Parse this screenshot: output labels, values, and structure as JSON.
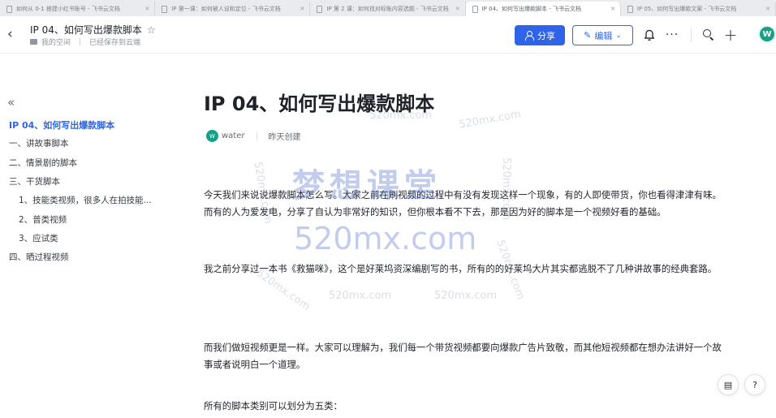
{
  "tabs": [
    {
      "label": "如何从 0-1 搭建小红书账号 - 飞书云文档",
      "active": false
    },
    {
      "label": "IP 第一课：如何被人设和定位 - 飞书云文档",
      "active": false
    },
    {
      "label": "IP 第 2 课：如何找对标账内容选题 - 飞书云文档",
      "active": false
    },
    {
      "label": "IP 04、如何写出爆款脚本 - 飞书云文档",
      "active": true
    },
    {
      "label": "IP 05、如何写出爆款文案 - 飞书云文档",
      "active": false
    }
  ],
  "header": {
    "title": "IP 04、如何写出爆款脚本",
    "location": "我的空间",
    "save_status": "已经保存到云端",
    "share_label": "分享",
    "edit_label": "编辑",
    "avatar_initial": "W"
  },
  "outline": {
    "items": [
      {
        "label": "IP 04、如何写出爆款脚本"
      },
      {
        "label": "一、讲故事脚本"
      },
      {
        "label": "二、情景剧的脚本"
      },
      {
        "label": "三、干货脚本"
      },
      {
        "label": "1、技能类视频，很多人在拍技能..."
      },
      {
        "label": "2、普类视频"
      },
      {
        "label": "3、应试类"
      },
      {
        "label": "四、晒过程视频"
      }
    ]
  },
  "document": {
    "title": "IP 04、如何写出爆款脚本",
    "author": "water",
    "author_initial": "W",
    "created": "昨天创建",
    "paragraphs": [
      "今天我们来说说爆款脚本怎么写。大家之前在刷视频的过程中有没有发现这样一个现象，有的人即使带货，你也看得津津有味。而有的人为爱发电，分享了自认为非常好的知识，但你根本看不下去，那是因为好的脚本是一个视频好看的基础。",
      "我之前分享过一本书《救猫咪》，这个是好莱坞资深编剧写的书，所有的的好莱坞大片其实都逃脱不了几种讲故事的经典套路。",
      "而我们做短视频更是一样。大家可以理解为，我们每一个带货视频都要向爆款广告片致敬，而其他短视频都在想办法讲好一个故事或者说明白一个道理。",
      "所有的脚本类别可以划分为五类："
    ]
  },
  "watermark": {
    "brand": "梦想课堂",
    "url": "520mx.com"
  }
}
